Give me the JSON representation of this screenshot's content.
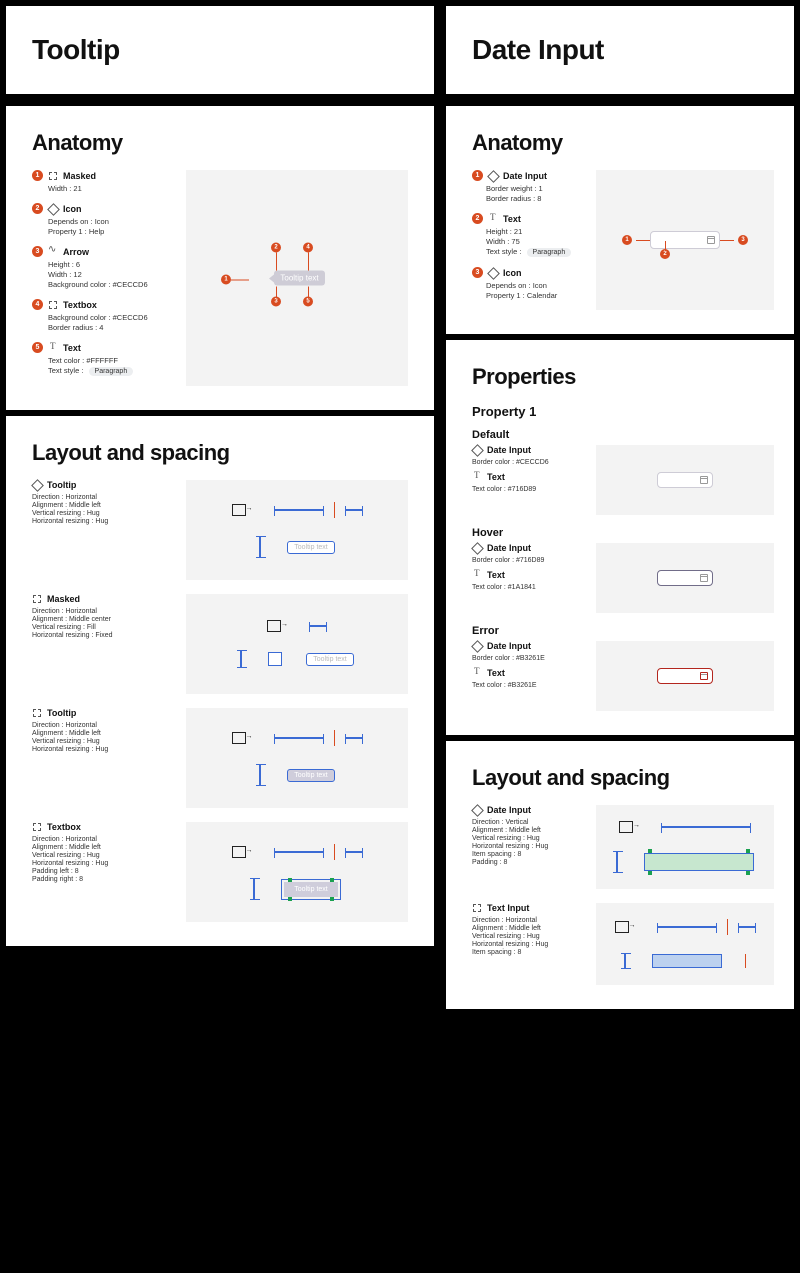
{
  "left": {
    "title": "Tooltip",
    "anatomy": {
      "heading": "Anatomy",
      "items": [
        {
          "n": "1",
          "name": "Masked",
          "props": [
            "Width : 21"
          ]
        },
        {
          "n": "2",
          "name": "Icon",
          "props": [
            "Depends on : Icon",
            "Property 1 : Help"
          ]
        },
        {
          "n": "3",
          "name": "Arrow",
          "props": [
            "Height : 6",
            "Width : 12",
            "Background color : #CECCD6"
          ]
        },
        {
          "n": "4",
          "name": "Textbox",
          "props": [
            "Background color : #CECCD6",
            "Border radius : 4"
          ]
        },
        {
          "n": "5",
          "name": "Text",
          "props": [
            "Text color : #FFFFFF"
          ],
          "badge": "Paragraph",
          "badgeLabel": "Text style :"
        }
      ],
      "previewText": "Tooltip text"
    },
    "layout": {
      "heading": "Layout and spacing",
      "items": [
        {
          "name": "Tooltip",
          "props": [
            "Direction : Horizontal",
            "Alignment : Middle left",
            "Vertical resizing : Hug",
            "Horizontal resizing : Hug"
          ]
        },
        {
          "name": "Masked",
          "props": [
            "Direction : Horizontal",
            "Alignment : Middle center",
            "Vertical resizing : Fill",
            "Horizontal resizing : Fixed"
          ]
        },
        {
          "name": "Tooltip",
          "props": [
            "Direction : Horizontal",
            "Alignment : Middle left",
            "Vertical resizing : Hug",
            "Horizontal resizing : Hug"
          ]
        },
        {
          "name": "Textbox",
          "props": [
            "Direction : Horizontal",
            "Alignment : Middle left",
            "Vertical resizing : Hug",
            "Horizontal resizing : Hug",
            "Padding left : 8",
            "Padding right : 8"
          ]
        }
      ],
      "previewText": "Tooltip text"
    }
  },
  "right": {
    "title": "Date Input",
    "anatomy": {
      "heading": "Anatomy",
      "items": [
        {
          "n": "1",
          "name": "Date Input",
          "props": [
            "Border weight : 1",
            "Border radius : 8"
          ]
        },
        {
          "n": "2",
          "name": "Text",
          "props": [
            "Height : 21",
            "Width : 75"
          ],
          "badge": "Paragraph",
          "badgeLabel": "Text style :"
        },
        {
          "n": "3",
          "name": "Icon",
          "props": [
            "Depends on : Icon",
            "Property 1 : Calendar"
          ]
        }
      ]
    },
    "properties": {
      "heading": "Properties",
      "sub": "Property 1",
      "states": [
        {
          "label": "Default",
          "inputBorder": "#CECCD6",
          "textColor": "#716D89",
          "lines": [
            {
              "icon": "diamond",
              "name": "Date Input",
              "prop": "Border color : #CECCD6"
            },
            {
              "icon": "text",
              "name": "Text",
              "prop": "Text color : #716D89"
            }
          ]
        },
        {
          "label": "Hover",
          "inputBorder": "#716D89",
          "textColor": "#1A1841",
          "lines": [
            {
              "icon": "diamond",
              "name": "Date Input",
              "prop": "Border color : #716D89"
            },
            {
              "icon": "text",
              "name": "Text",
              "prop": "Text color : #1A1841"
            }
          ]
        },
        {
          "label": "Error",
          "inputBorder": "#B3261E",
          "textColor": "#B3261E",
          "lines": [
            {
              "icon": "diamond",
              "name": "Date Input",
              "prop": "Border color : #B3261E"
            },
            {
              "icon": "text",
              "name": "Text",
              "prop": "Text color : #B3261E"
            }
          ]
        }
      ]
    },
    "layout": {
      "heading": "Layout and spacing",
      "items": [
        {
          "name": "Date Input",
          "props": [
            "Direction : Vertical",
            "Alignment : Middle left",
            "Vertical resizing : Hug",
            "Horizontal resizing : Hug",
            "Item spacing : 8",
            "Padding : 8"
          ]
        },
        {
          "name": "Text Input",
          "props": [
            "Direction : Horizontal",
            "Alignment : Middle left",
            "Vertical resizing : Hug",
            "Horizontal resizing : Hug",
            "Item spacing : 8"
          ]
        }
      ]
    }
  }
}
